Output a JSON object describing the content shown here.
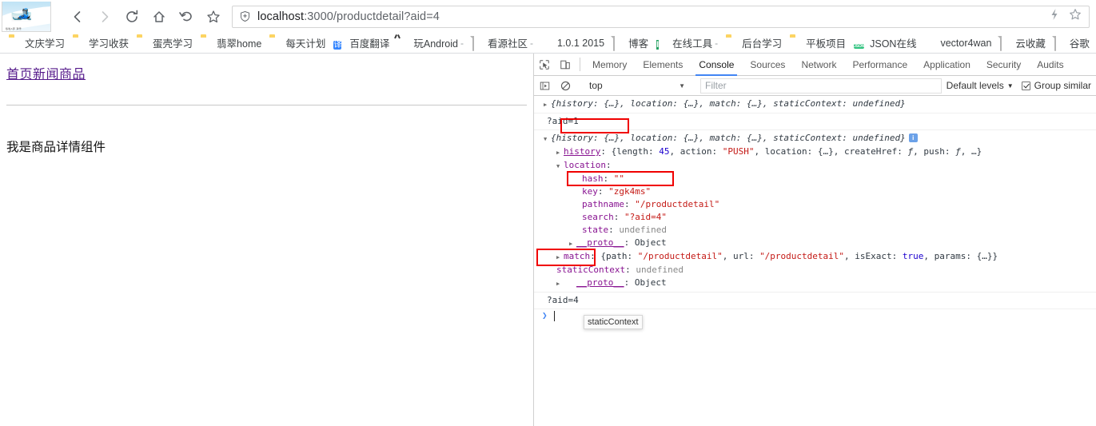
{
  "browser": {
    "tab_favicon_caption": "哆啦A梦 滑雪",
    "nav": {
      "back_label": "Back",
      "forward_label": "Forward",
      "reload_label": "Reload",
      "home_label": "Home",
      "history_label": "History",
      "bookmark_label": "Bookmark this page"
    },
    "omnibox": {
      "url_host": "localhost",
      "url_rest": ":3000/productdetail?aid=4",
      "full_url": "localhost:3000/productdetail?aid=4",
      "shield_icon": "shield-icon",
      "flash_icon": "lightning-icon",
      "star_icon": "star-icon"
    },
    "bookmarks": [
      {
        "label": "文庆学习",
        "icon": "folder-icon"
      },
      {
        "label": "学习收获",
        "icon": "folder-icon"
      },
      {
        "label": "蛋壳学习",
        "icon": "folder-icon"
      },
      {
        "label": "翡翠home",
        "icon": "folder-icon"
      },
      {
        "label": "每天计划",
        "icon": "folder-icon"
      },
      {
        "label": "百度翻译",
        "icon": "baidu-fanyi-icon"
      },
      {
        "label": "玩Android",
        "icon": "android-icon",
        "trailing": "-"
      },
      {
        "label": "看源社区",
        "icon": "page-icon",
        "trailing": "-"
      },
      {
        "label": "1.0.1 2015",
        "icon": "green-circle-icon"
      },
      {
        "label": "博客",
        "icon": "page-icon"
      },
      {
        "label": "在线工具",
        "icon": "tool-t-icon",
        "trailing": "-"
      },
      {
        "label": "后台学习",
        "icon": "folder-icon"
      },
      {
        "label": "平板项目",
        "icon": "folder-icon"
      },
      {
        "label": "JSON在线",
        "icon": "json-icon"
      },
      {
        "label": "vector4wan",
        "icon": "github-icon"
      },
      {
        "label": "云收藏",
        "icon": "page-icon"
      },
      {
        "label": "谷歌",
        "icon": "page-icon"
      }
    ]
  },
  "page": {
    "nav_link": "首页新闻商品",
    "body_text": "我是商品详情组件"
  },
  "devtools": {
    "toolbar_icons": {
      "inspect": "inspect-element-icon",
      "device": "device-toolbar-icon"
    },
    "tabs": [
      {
        "label": "Memory",
        "active": false
      },
      {
        "label": "Elements",
        "active": false
      },
      {
        "label": "Console",
        "active": true
      },
      {
        "label": "Sources",
        "active": false
      },
      {
        "label": "Network",
        "active": false
      },
      {
        "label": "Performance",
        "active": false
      },
      {
        "label": "Application",
        "active": false
      },
      {
        "label": "Security",
        "active": false
      },
      {
        "label": "Audits",
        "active": false
      }
    ],
    "filterbar": {
      "execute_icon": "console-sidebar-icon",
      "clear_icon": "clear-console-icon",
      "context": "top",
      "context_caret": "▼",
      "filter_placeholder": "Filter",
      "levels_label": "Default levels",
      "levels_caret": "▼",
      "group_similar_label": "Group similar",
      "group_similar_checked": true
    },
    "console": {
      "entries": [
        {
          "type": "object-collapsed",
          "arrow": "▶",
          "text": "{history: {…}, location: {…}, match: {…}, staticContext: undefined}"
        },
        {
          "type": "result",
          "text": "?aid=1"
        },
        {
          "type": "object-expanded",
          "arrow": "▼",
          "header": "{history: {…}, location: {…}, match: {…}, staticContext: undefined}",
          "has_info_badge": true,
          "children": [
            {
              "arrow": "▶",
              "key": "history",
              "value": "{length: 45, action: \"PUSH\", location: {…}, createHref: ƒ, push: ƒ, …}",
              "num": "45",
              "str": "\"PUSH\""
            },
            {
              "arrow": "▼",
              "key": "location",
              "value": ":",
              "highlighted": true
            },
            {
              "key": "hash",
              "value": "\"\""
            },
            {
              "key": "key",
              "value": "\"zgk4ms\""
            },
            {
              "key": "pathname",
              "value": "\"/productdetail\""
            },
            {
              "key": "search",
              "value": "\"?aid=4\"",
              "highlighted": true
            },
            {
              "key": "state",
              "value": "undefined"
            },
            {
              "arrow": "▶",
              "key": "__proto__",
              "value": "Object"
            },
            {
              "arrow": "▶",
              "key": "match",
              "value": "{path: \"/productdetail\", url: \"/productdetail\", isExact: true, params: {…}}"
            },
            {
              "key": "staticContext",
              "value": "undefined"
            },
            {
              "arrow": "▶",
              "key": "__proto__",
              "value": "Object"
            }
          ]
        },
        {
          "type": "result",
          "text": "?aid=4",
          "highlighted": true
        }
      ],
      "tooltip_text": "staticContext",
      "prompt_caret": "❯"
    }
  }
}
